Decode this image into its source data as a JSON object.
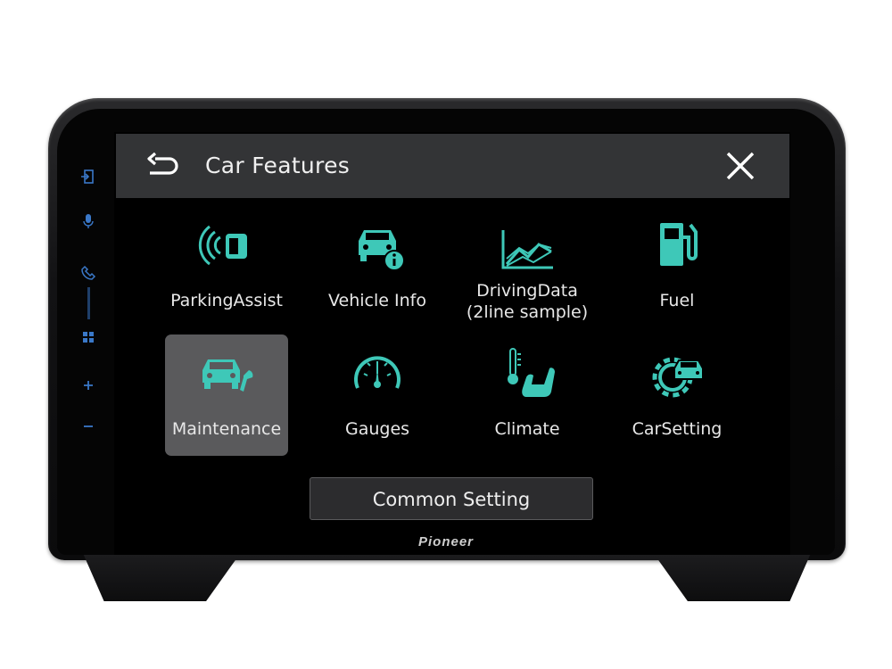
{
  "header": {
    "title": "Car Features",
    "back_icon": "back-arrow-icon",
    "close_icon": "close-icon"
  },
  "features": [
    {
      "label": "ParkingAssist",
      "icon": "parking-sensor-icon",
      "selected": false
    },
    {
      "label": "Vehicle Info",
      "icon": "car-info-icon",
      "selected": false
    },
    {
      "label": "DrivingData\n(2line sample)",
      "icon": "driving-chart-icon",
      "selected": false
    },
    {
      "label": "Fuel",
      "icon": "fuel-pump-icon",
      "selected": false
    },
    {
      "label": "Maintenance",
      "icon": "car-wrench-icon",
      "selected": true
    },
    {
      "label": "Gauges",
      "icon": "speedometer-icon",
      "selected": false
    },
    {
      "label": "Climate",
      "icon": "thermometer-seat-icon",
      "selected": false
    },
    {
      "label": "CarSetting",
      "icon": "gear-car-icon",
      "selected": false
    }
  ],
  "common_setting": {
    "label": "Common Setting"
  },
  "side_rail": [
    "source-icon",
    "mic-icon",
    "phone-icon",
    "apps-icon",
    "volume-up-icon",
    "volume-down-icon"
  ],
  "brand": {
    "logo": "Pioneer"
  },
  "colors": {
    "accent": "#3ec8b8",
    "header_bg": "#333436",
    "selected_tile": "#5a5a5c"
  }
}
